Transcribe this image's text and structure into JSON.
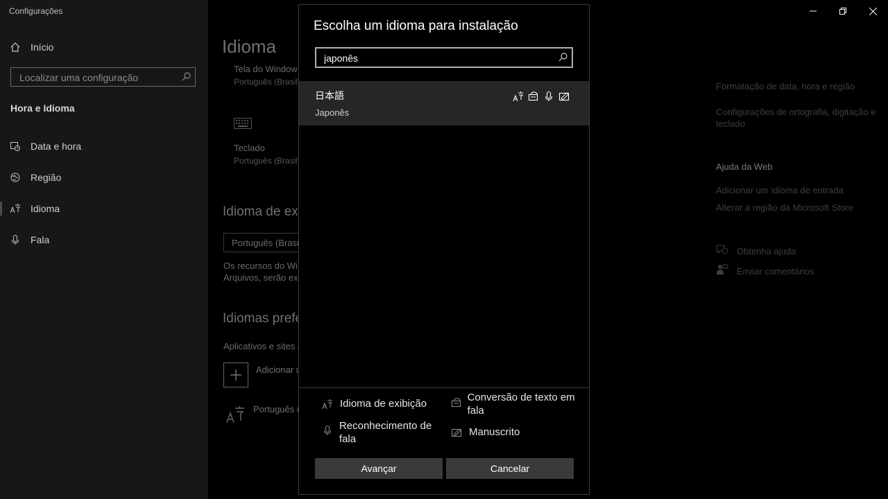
{
  "app": {
    "title": "Configurações"
  },
  "sidebar": {
    "home_label": "Início",
    "search_placeholder": "Localizar uma configuração",
    "section_title": "Hora e Idioma",
    "items": [
      {
        "label": "Data e hora",
        "icon": "calendar-clock-icon"
      },
      {
        "label": "Região",
        "icon": "globe-icon"
      },
      {
        "label": "Idioma",
        "icon": "language-icon"
      },
      {
        "label": "Fala",
        "icon": "microphone-icon"
      }
    ]
  },
  "main": {
    "title": "Idioma",
    "windows_display_label": "Tela do Window",
    "windows_display_value": "Português (Brasil)",
    "keyboard_label": "Teclado",
    "keyboard_value": "Português (Brasil)",
    "display_language_heading": "Idioma de exi",
    "display_language_value": "Português (Brasil",
    "display_language_desc_1": "Os recursos do Wi",
    "display_language_desc_2": "Arquivos, serão exi",
    "preferred_heading": "Idiomas prefe",
    "preferred_desc": "Aplicativos e sites a",
    "add_language_label": "Adicionar u",
    "preferred_item": "Português ("
  },
  "right_panel": {
    "links_top": [
      "Formatação de data, hora e região",
      "Configurações de ortografia, digitação e teclado"
    ],
    "web_help_heading": "Ajuda da Web",
    "web_links": [
      "Adicionar um idioma de entrada",
      "Alterar a região da Microsoft Store"
    ],
    "get_help": "Obtenha ajuda",
    "feedback": "Enviar comentários"
  },
  "dialog": {
    "title": "Escolha um idioma para instalação",
    "search_value": "japonês",
    "result": {
      "native_name": "日本語",
      "english_name": "Japonês",
      "feature_icons": [
        "display-language-icon",
        "text-to-speech-icon",
        "speech-recognition-icon",
        "handwriting-icon"
      ]
    },
    "legend": {
      "display_language": "Idioma de exibição",
      "text_to_speech": "Conversão de texto em fala",
      "speech_recognition": "Reconhecimento de fala",
      "handwriting": "Manuscrito"
    },
    "next_button": "Avançar",
    "cancel_button": "Cancelar"
  }
}
